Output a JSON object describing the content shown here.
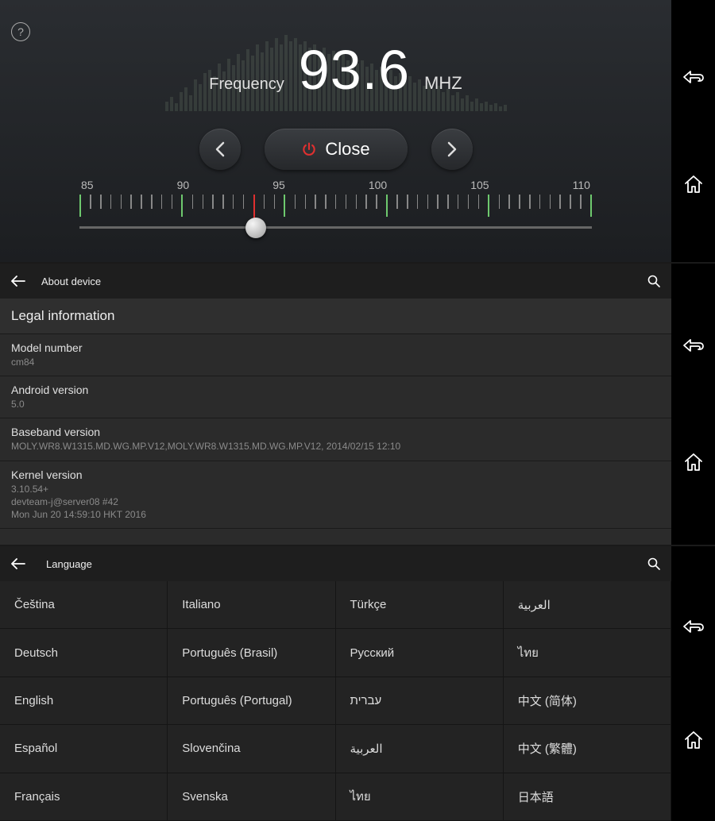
{
  "radio": {
    "freq_label": "Frequency",
    "freq_value": "93.6",
    "freq_unit": "MHZ",
    "close_label": "Close",
    "dial_labels": [
      "85",
      "90",
      "95",
      "100",
      "105",
      "110"
    ],
    "dial_min": 85,
    "dial_max": 110,
    "indicator_value": 93.6
  },
  "about": {
    "header_title": "About device",
    "legal_title": "Legal information",
    "rows": [
      {
        "label": "Model number",
        "value": "cm84"
      },
      {
        "label": "Android version",
        "value": "5.0"
      },
      {
        "label": "Baseband version",
        "value": "MOLY.WR8.W1315.MD.WG.MP.V12,MOLY.WR8.W1315.MD.WG.MP.V12, 2014/02/15 12:10"
      },
      {
        "label": "Kernel version",
        "value": "3.10.54+\ndevteam-j@server08 #42\nMon Jun 20 14:59:10 HKT 2016"
      }
    ]
  },
  "language": {
    "header_title": "Language",
    "items": [
      "Čeština",
      "Italiano",
      "Türkçe",
      "العربية",
      "Deutsch",
      "Português (Brasil)",
      "Русский",
      "ไทย",
      "English",
      "Português (Portugal)",
      "עברית",
      "中文 (简体)",
      "Español",
      "Slovenčina",
      "العربية",
      "中文 (繁體)",
      "Français",
      "Svenska",
      "ไทย",
      "日本語"
    ]
  }
}
